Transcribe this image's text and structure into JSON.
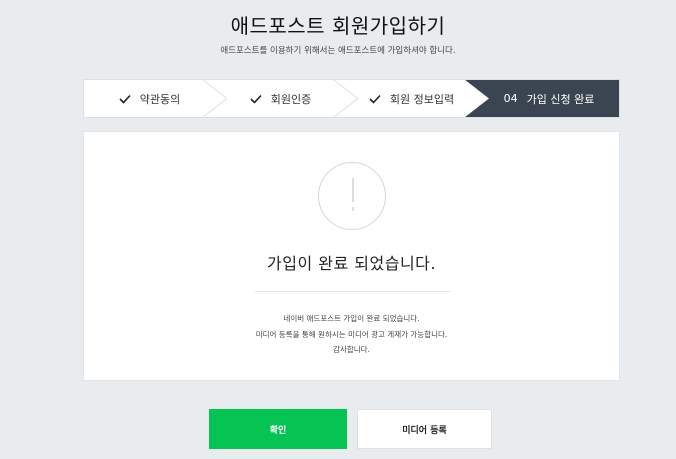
{
  "header": {
    "title": "애드포스트 회원가입하기",
    "subtitle": "애드포스트를 이용하기 위해서는 애드포스트에 가입하셔야 합니다."
  },
  "steps": [
    {
      "label": "약관동의",
      "state": "done"
    },
    {
      "label": "회원인증",
      "state": "done"
    },
    {
      "label": "회원 정보입력",
      "state": "done"
    },
    {
      "number": "04",
      "label": "가입 신청 완료",
      "state": "current"
    }
  ],
  "card": {
    "icon": "exclamation-circle-icon",
    "message": "가입이 완료 되었습니다.",
    "info_lines": [
      "네이버 애드포스트 가입이 완료 되었습니다.",
      "미디어 등록을 통해 원하시는 미디어 광고 게재가 가능합니다.",
      "감사합니다."
    ]
  },
  "buttons": {
    "confirm_label": "확인",
    "media_label": "미디어 등록"
  },
  "colors": {
    "accent_green": "#06c453",
    "current_step_bg": "#3b4551",
    "page_bg": "#e9ecef"
  }
}
